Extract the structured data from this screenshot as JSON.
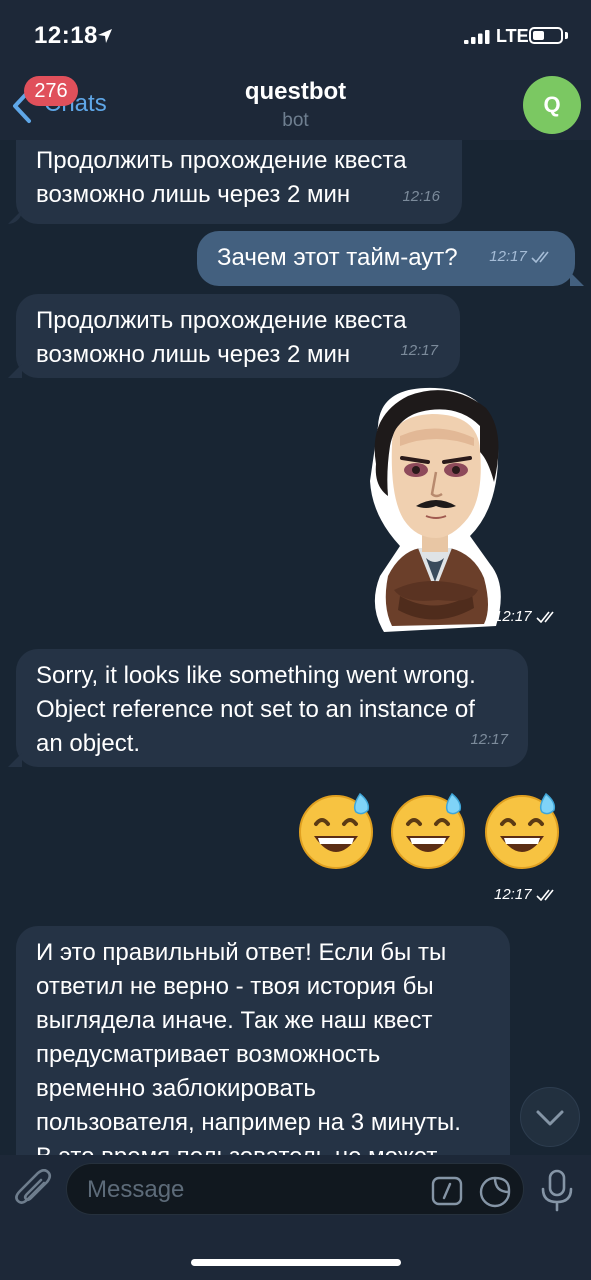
{
  "status_bar": {
    "time": "12:18",
    "network": "LTE"
  },
  "nav": {
    "back_label": "Chats",
    "unread_badge": "276",
    "title": "questbot",
    "subtitle": "bot",
    "avatar_letter": "Q",
    "avatar_color": "#7bc862"
  },
  "messages": [
    {
      "direction": "in",
      "text": "Продолжить прохождение квеста\nвозможно лишь через 2 мин",
      "time": "12:16"
    },
    {
      "direction": "out",
      "text": "Зачем этот тайм-аут?",
      "time": "12:17"
    },
    {
      "direction": "in",
      "text": "Продолжить прохождение квеста\nвозможно лишь через 2 мин",
      "time": "12:17"
    },
    {
      "direction": "out",
      "type": "sticker",
      "sticker": "poe-crossed-arms",
      "time": "12:17"
    },
    {
      "direction": "in",
      "text": "Sorry, it looks like something went wrong.\nObject reference not set to an instance of\nan object.",
      "time": "12:17"
    },
    {
      "direction": "out",
      "type": "emoji",
      "emoji": "😅😅😅",
      "time": "12:17"
    },
    {
      "direction": "in",
      "text": "И это правильный ответ! Если бы ты\nответил не верно - твоя история бы\nвыглядела иначе. Так же наш квест\nпредусматривает возможность\nвременно заблокировать\nпользователя, например на 3 минуты.\nВ это время пользователь не может"
    }
  ],
  "input": {
    "placeholder": "Message"
  },
  "icons": {
    "back": "chevron-left-icon",
    "attach": "paperclip-icon",
    "command": "bot-command-icon",
    "sticker": "sticker-icon",
    "mic": "microphone-icon",
    "scroll": "chevron-down-icon"
  },
  "colors": {
    "background": "#182533",
    "incoming": "#253345",
    "outgoing": "#43607f",
    "accent": "#5fa7e8",
    "badge": "#e0505b"
  }
}
